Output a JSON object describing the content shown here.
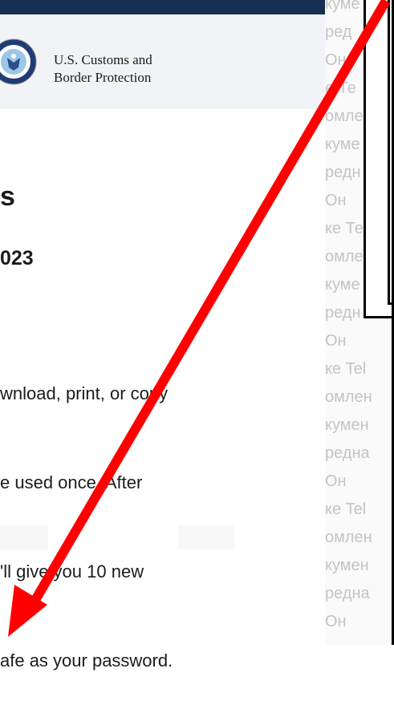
{
  "header": {
    "agency_line1": "U.S. Customs and",
    "agency_line2": "Border Protection"
  },
  "page": {
    "title_fragment": "s",
    "date_fragment": "023",
    "paragraph_lines": [
      "wnload, print, or copy",
      "e used once. After",
      "'ll give you 10 new",
      "afe as your password."
    ]
  },
  "overlay": {
    "background_lines": [
      "куме",
      "ред",
      "Он",
      "е Те",
      "омле",
      "куме",
      "редн",
      "Он",
      "ке Те",
      "омле",
      "куме",
      "редн",
      "Он",
      "ке Tel",
      "омлен",
      "кумен",
      "редна",
      "Он",
      "ке Tel",
      "омлен",
      "кумен",
      "редна",
      "Он"
    ]
  },
  "colors": {
    "top_bar": "#162e51",
    "header_bg": "#f1f3f6",
    "arrow": "#ff0000"
  }
}
